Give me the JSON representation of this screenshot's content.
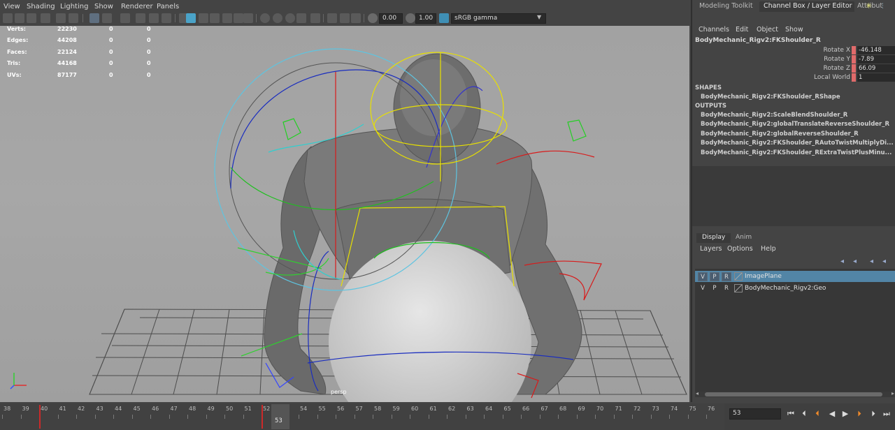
{
  "viewport": {
    "menu": [
      "View",
      "Shading",
      "Lighting",
      "Show",
      "Renderer",
      "Panels"
    ],
    "toolbar": {
      "exposure": "0.00",
      "gamma": "1.00",
      "color_space": "sRGB gamma"
    },
    "hud": [
      {
        "label": "Verts:",
        "v1": "22230",
        "v2": "0",
        "v3": "0"
      },
      {
        "label": "Edges:",
        "v1": "44208",
        "v2": "0",
        "v3": "0"
      },
      {
        "label": "Faces:",
        "v1": "22124",
        "v2": "0",
        "v3": "0"
      },
      {
        "label": "Tris:",
        "v1": "44168",
        "v2": "0",
        "v3": "0"
      },
      {
        "label": "UVs:",
        "v1": "87177",
        "v2": "0",
        "v3": "0"
      }
    ],
    "camera": "persp"
  },
  "side_panel": {
    "tabs": [
      "Modeling Toolkit",
      "Channel Box / Layer Editor",
      "Attribut"
    ],
    "channel_menu": [
      "Channels",
      "Edit",
      "Object",
      "Show"
    ],
    "node_name": "BodyMechanic_Rigv2:FKShoulder_R",
    "attributes": [
      {
        "label": "Rotate X",
        "value": "-46.148"
      },
      {
        "label": "Rotate Y",
        "value": "-7.89"
      },
      {
        "label": "Rotate Z",
        "value": "66.09"
      },
      {
        "label": "Local World",
        "value": "1"
      }
    ],
    "shapes_header": "SHAPES",
    "shapes": [
      "BodyMechanic_Rigv2:FKShoulder_RShape"
    ],
    "outputs_header": "OUTPUTS",
    "outputs": [
      "BodyMechanic_Rigv2:ScaleBlendShoulder_R",
      "BodyMechanic_Rigv2:globalTranslateReverseShoulder_R",
      "BodyMechanic_Rigv2:globalReverseShoulder_R",
      "BodyMechanic_Rigv2:FKShoulder_RAutoTwistMultiplyDi...",
      "BodyMechanic_Rigv2:FKShoulder_RExtraTwistPlusMinu..."
    ],
    "layer_tabs": [
      "Display",
      "Anim"
    ],
    "layer_menu": [
      "Layers",
      "Options",
      "Help"
    ],
    "layers": [
      {
        "v": "V",
        "p": "P",
        "r": "R",
        "name": "ImagePlane",
        "selected": true
      },
      {
        "v": "V",
        "p": "P",
        "r": "R",
        "name": "BodyMechanic_Rigv2:Geo",
        "selected": false
      }
    ]
  },
  "timeline": {
    "ticks": [
      "38",
      "39",
      "40",
      "41",
      "42",
      "43",
      "44",
      "45",
      "46",
      "47",
      "48",
      "49",
      "50",
      "51",
      "52",
      "53",
      "54",
      "55",
      "56",
      "57",
      "58",
      "59",
      "60",
      "61",
      "62",
      "63",
      "64",
      "65",
      "66",
      "67",
      "68",
      "69",
      "70",
      "71",
      "72",
      "73",
      "74",
      "75",
      "76"
    ],
    "current_frame": "53",
    "frame_field": "53",
    "keyframes": [
      "40",
      "52"
    ]
  }
}
